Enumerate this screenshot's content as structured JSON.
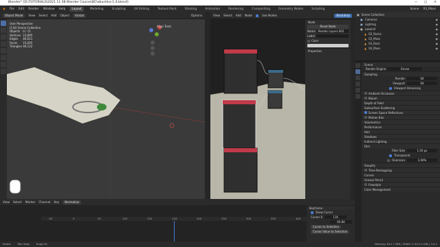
{
  "window": {
    "title": "Blender* [D:\\TUTORIALS\\2021 11 08 Blender Course\\BC\\ebunhka-1.4.blend]"
  },
  "menubar": {
    "menus": [
      "File",
      "Edit",
      "Render",
      "Window",
      "Help"
    ],
    "workspaces": [
      "Layout",
      "Modeling",
      "Sculpting",
      "UV Editing",
      "Texture Paint",
      "Shading",
      "Animation",
      "Rendering",
      "Compositing",
      "Geometry Nodes",
      "Scripting"
    ],
    "active_workspace": "Layout",
    "scene": "Scene",
    "view_layer": "03_Mass"
  },
  "viewport_header": {
    "mode": "Object Mode",
    "menus": [
      "View",
      "Select",
      "Add",
      "Object"
    ],
    "orientation": "Global",
    "options": "Options"
  },
  "viewport_info": {
    "perspective": "User Perspective",
    "collection": "(116) Scene Collection",
    "stats": [
      {
        "label": "Objects",
        "value": "0 / 11"
      },
      {
        "label": "Vertices",
        "value": "23,895"
      },
      {
        "label": "Edges",
        "value": "46,611"
      },
      {
        "label": "Faces",
        "value": "23,005"
      },
      {
        "label": "Triangles",
        "value": "46,122"
      }
    ]
  },
  "align_tools": "Align Tools",
  "node_header": {
    "menus": [
      "View",
      "Select",
      "Add",
      "Node"
    ],
    "use_nodes": "Use Nodes",
    "backdrop": "Backdrop"
  },
  "node_panel": {
    "section": "Node",
    "reset": "Reset Node",
    "name_label": "Name",
    "name_value": "Render Layers.002",
    "label_label": "Label",
    "color_label": "Color",
    "properties_label": "Properties"
  },
  "outliner": {
    "title": "Scene Collection",
    "items": [
      "Cameras",
      "Lighting",
      "Lakehill",
      "02_Rocks",
      "03_Mass",
      "03_Rock",
      "04_Mass"
    ]
  },
  "properties": {
    "scene_label": "Scene",
    "render_engine_label": "Render Engine",
    "render_engine": "Eevee",
    "sampling": "Sampling",
    "render_label": "Render",
    "render_samples": "64",
    "viewport_label": "Viewport",
    "viewport_samples": "64",
    "viewport_denoising": "Viewport Denoising",
    "sections": [
      "Ambient Occlusion",
      "Bloom",
      "Depth of Field",
      "Subsurface Scattering",
      "Screen Space Reflections",
      "Motion Blur",
      "Volumetrics",
      "Performance",
      "Hair",
      "Shadows",
      "Indirect Lighting",
      "Film"
    ],
    "filter_size_label": "Filter Size",
    "filter_size": "1.50 px",
    "transparent": "Transparent",
    "overscan_label": "Overscan",
    "overscan": "3.00%",
    "sections2": [
      "Simplify",
      "Grease Pencil",
      "Freestyle",
      "Color Management"
    ],
    "time_stretching": "Time Remapping",
    "curves": "Curves"
  },
  "timeline": {
    "menus": [
      "View",
      "Select",
      "Marker",
      "Channel",
      "Key"
    ],
    "mode": "Normalize",
    "ticks": [
      "-50",
      "0",
      "50",
      "100",
      "150",
      "200",
      "250",
      "300",
      "350",
      "400",
      "450"
    ],
    "current_frame": "116",
    "right_panel": {
      "title": "Keyframe",
      "show_cursor": "Show Cursor",
      "cursor_x_label": "Cursor X",
      "cursor_x": "116",
      "cursor_y": "60.84",
      "cursor_to_selection": "Cursor to Selection",
      "cursor_value": "Cursor Value to Selection"
    }
  },
  "statusbar": {
    "items": [
      "Select",
      "Pan View",
      "Snap On"
    ],
    "version": "Memory: 812.7 MiB | VRAM: 2.3/11.0 GiB | 3.0.1"
  },
  "colors": {
    "accent": "#4a7bd0",
    "node_header": "#c03a4a",
    "ground": "#d6d4c6"
  }
}
